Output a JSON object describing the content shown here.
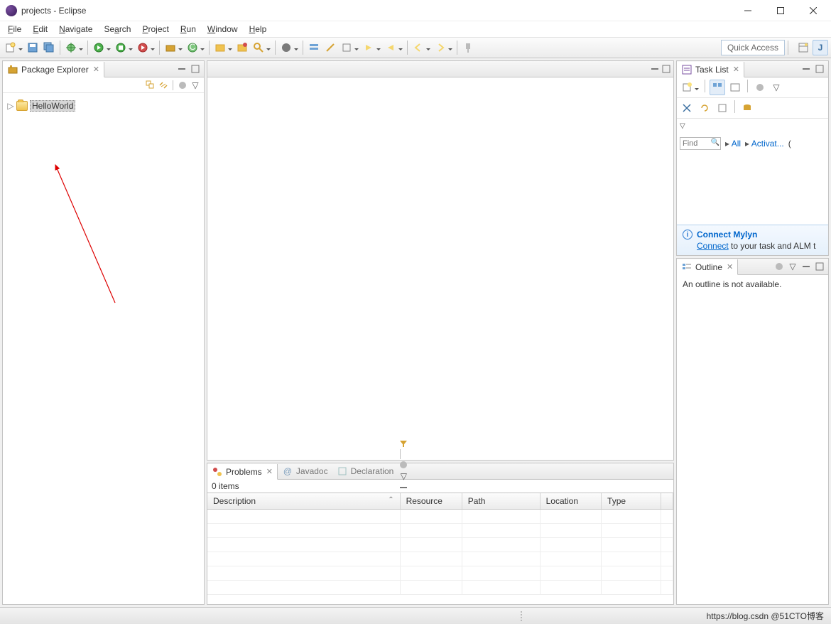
{
  "window": {
    "title": "projects - Eclipse"
  },
  "menu": {
    "file": "File",
    "edit": "Edit",
    "navigate": "Navigate",
    "search": "Search",
    "project": "Project",
    "run": "Run",
    "window": "Window",
    "help": "Help"
  },
  "toolbar": {
    "quick_access": "Quick Access"
  },
  "package_explorer": {
    "title": "Package Explorer",
    "project": "HelloWorld"
  },
  "task_list": {
    "title": "Task List",
    "find_placeholder": "Find",
    "all": "All",
    "activate": "Activat...",
    "connect_title": "Connect Mylyn",
    "connect_link": "Connect",
    "connect_text": " to your task and ALM t"
  },
  "outline": {
    "title": "Outline",
    "empty": "An outline is not available."
  },
  "problems": {
    "tab_problems": "Problems",
    "tab_javadoc": "Javadoc",
    "tab_declaration": "Declaration",
    "count": "0 items",
    "cols": {
      "description": "Description",
      "resource": "Resource",
      "path": "Path",
      "location": "Location",
      "type": "Type"
    }
  },
  "status": {
    "watermark": "https://blog.csdn @51CTO博客"
  }
}
